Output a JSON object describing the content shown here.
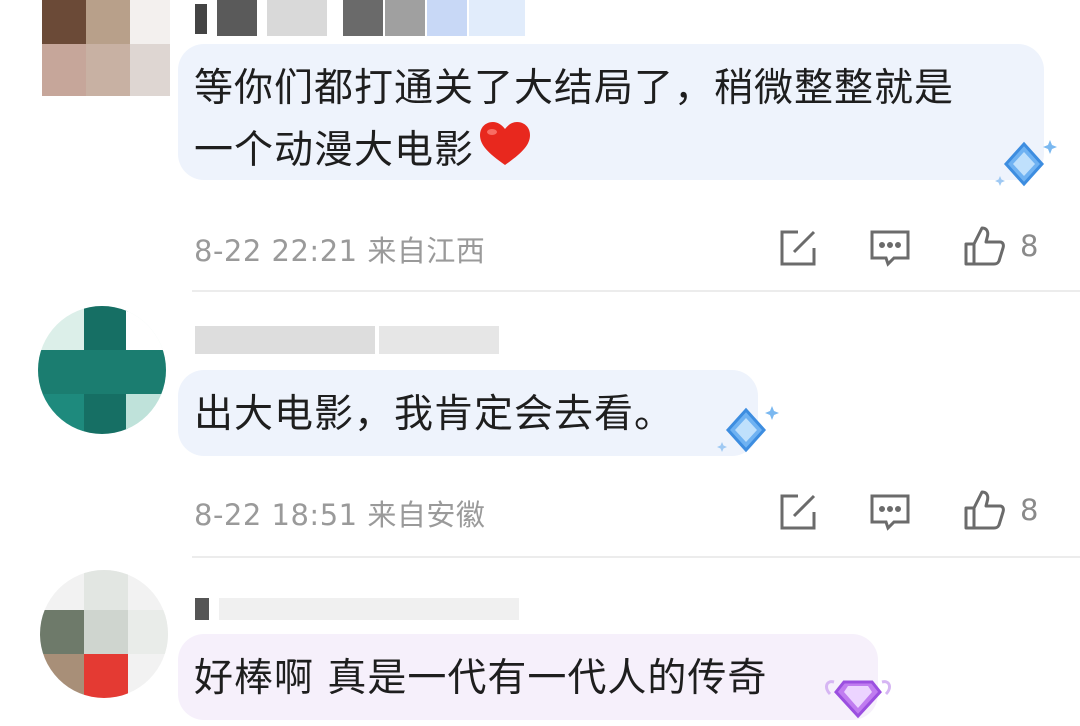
{
  "comments": [
    {
      "text": "等你们都打通关了大结局了，稍微整整就是\n一个动漫大电影",
      "time": "8-22 22:21",
      "location": "来自江西",
      "likes": "8",
      "has_heart": true,
      "bubble_color": "#eef3fc",
      "badge": "blue-diamond-badge"
    },
    {
      "text": "出大电影，我肯定会去看。",
      "time": "8-22 18:51",
      "location": "来自安徽",
      "likes": "8",
      "has_heart": false,
      "bubble_color": "#eef3fc",
      "badge": "blue-diamond-badge"
    },
    {
      "text": "好棒啊 真是一代有一代人的传奇",
      "has_heart": false,
      "bubble_color": "#f6f0fb",
      "badge": "purple-gem-badge"
    }
  ],
  "icons": {
    "edit": "edit-icon",
    "reply": "comment-icon",
    "like": "thumbs-up-icon",
    "heart": "red-heart-icon"
  },
  "colors": {
    "meta_text": "#9a9a9a",
    "icon_stroke": "#6b6b6b",
    "divider": "#ececec",
    "heart": "#e8281e"
  }
}
